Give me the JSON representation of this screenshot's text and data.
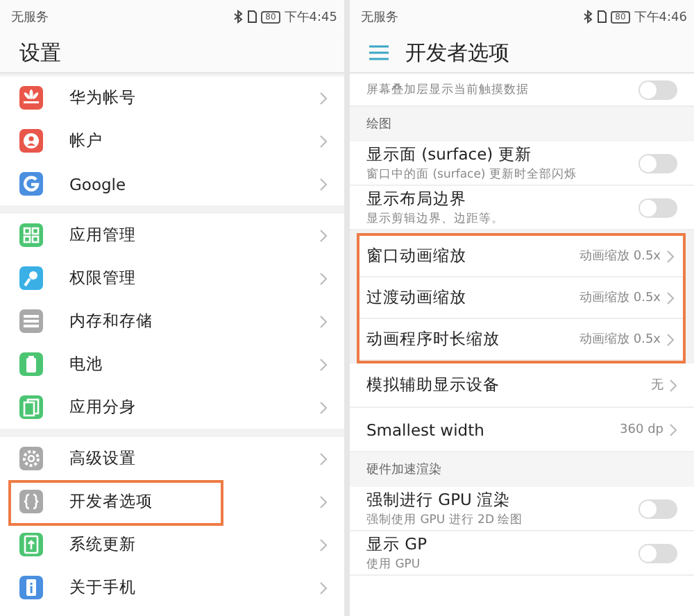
{
  "left": {
    "status": {
      "carrier": "无服务",
      "battery": "80",
      "time": "下午4:45"
    },
    "title": "设置",
    "groups": [
      [
        {
          "label": "华为帐号",
          "kind": "flower",
          "color": "#e9574a",
          "highlighted": false
        },
        {
          "label": "帐户",
          "kind": "person",
          "color": "#e9574a",
          "highlighted": false
        },
        {
          "label": "Google",
          "kind": "g",
          "color": "#4a8fe0",
          "highlighted": false
        }
      ],
      [
        {
          "label": "应用管理",
          "kind": "grid",
          "color": "#4cc573",
          "highlighted": false
        },
        {
          "label": "权限管理",
          "kind": "key",
          "color": "#3ab0e6",
          "highlighted": false
        },
        {
          "label": "内存和存储",
          "kind": "list",
          "color": "#a9a9a9",
          "highlighted": false
        },
        {
          "label": "电池",
          "kind": "battery",
          "color": "#4cc573",
          "highlighted": false
        },
        {
          "label": "应用分身",
          "kind": "clone",
          "color": "#4cc573",
          "highlighted": false
        }
      ],
      [
        {
          "label": "高级设置",
          "kind": "gear",
          "color": "#a9a9a9",
          "highlighted": false
        },
        {
          "label": "开发者选项",
          "kind": "braces",
          "color": "#a9a9a9",
          "highlighted": true
        },
        {
          "label": "系统更新",
          "kind": "update",
          "color": "#4cc573",
          "highlighted": false
        },
        {
          "label": "关于手机",
          "kind": "info",
          "color": "#4a8fe0",
          "highlighted": false
        }
      ]
    ]
  },
  "right": {
    "status": {
      "carrier": "无服务",
      "battery": "80",
      "time": "下午4:46"
    },
    "title": "开发者选项",
    "items": [
      {
        "kind": "partial",
        "subtitle": "屏幕叠加层显示当前触摸数据",
        "on": false
      },
      {
        "kind": "section",
        "label": "绘图"
      },
      {
        "kind": "toggle",
        "label": "显示面 (surface) 更新",
        "subtitle": "窗口中的面 (surface) 更新时全部闪烁",
        "on": false
      },
      {
        "kind": "toggle",
        "label": "显示布局边界",
        "subtitle": "显示剪辑边界、边距等。",
        "on": false
      },
      {
        "kind": "highlight",
        "items": [
          {
            "label": "窗口动画缩放",
            "value": "动画缩放 0.5x"
          },
          {
            "label": "过渡动画缩放",
            "value": "动画缩放 0.5x"
          },
          {
            "label": "动画程序时长缩放",
            "value": "动画缩放 0.5x"
          }
        ]
      },
      {
        "kind": "value",
        "label": "模拟辅助显示设备",
        "value": "无"
      },
      {
        "kind": "value",
        "label": "Smallest width",
        "value": "360 dp"
      },
      {
        "kind": "section",
        "label": "硬件加速渲染"
      },
      {
        "kind": "toggle",
        "label": "强制进行 GPU 渲染",
        "subtitle": "强制使用 GPU 进行 2D 绘图",
        "on": false
      },
      {
        "kind": "toggle",
        "label": "显示 GP",
        "subtitle": "使用 GPU",
        "on": false
      }
    ]
  }
}
